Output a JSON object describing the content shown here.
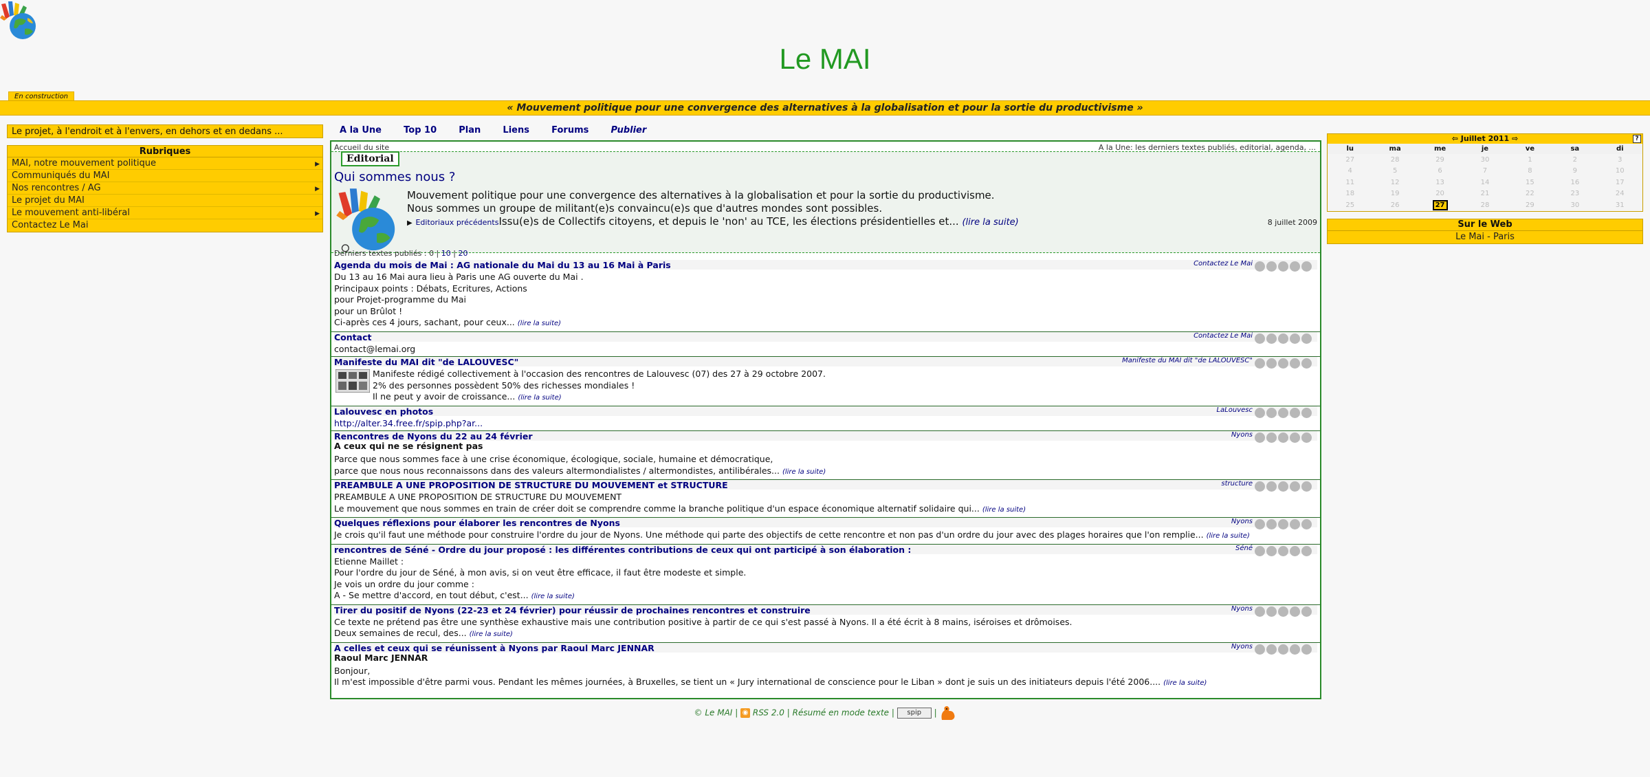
{
  "site": {
    "title": "Le MAI",
    "construction": "En construction",
    "slogan": "« Mouvement politique pour une convergence des alternatives à la globalisation et pour la sortie du productivisme »"
  },
  "left": {
    "projet_link": "Le projet, à l'endroit et à l'envers, en dehors et en dedans ...",
    "rubriques_title": "Rubriques",
    "rubriques": [
      {
        "label": "MAI, notre mouvement politique"
      },
      {
        "label": "Communiqués du MAI"
      },
      {
        "label": "Nos rencontres / AG"
      },
      {
        "label": "Le projet du MAI"
      },
      {
        "label": "Le mouvement anti-libéral"
      },
      {
        "label": "Contactez Le Mai"
      }
    ]
  },
  "nav": {
    "items": [
      "A la Une",
      "Top 10",
      "Plan",
      "Liens",
      "Forums",
      "Publier"
    ]
  },
  "center": {
    "crumb": "Accueil du site",
    "crumb_right": "A la Une: les derniers textes publiés, editorial, agenda, ...",
    "editorial_tab": "Editorial",
    "editorial_title": "Qui sommes nous ?",
    "editorial_line1": "Mouvement politique pour une convergence des alternatives à la globalisation et pour la sortie du productivisme.",
    "editorial_line2": "Nous sommes un groupe de militant(e)s convaincu(e)s que d'autres mondes sont possibles.",
    "editorial_prev": "Editoriaux précédents",
    "editorial_line3": "Issu(e)s de Collectifs citoyens, et depuis le 'non' au TCE, les élections présidentielles et...",
    "editorial_more": "(lire la suite)",
    "editorial_date": "8 juillet 2009",
    "derniers_label": "Derniers textes publiés : 0 |",
    "derniers_10": "10",
    "derniers_sep": "|",
    "derniers_20": "20",
    "lire": "(lire la suite)"
  },
  "articles": [
    {
      "title": "Agenda du mois de Mai : AG nationale du Mai du 13 au 16 Mai à Paris",
      "rubrique": "Contactez Le Mai",
      "lines": [
        "Du 13 au 16 Mai aura lieu à Paris une AG ouverte du Mai .",
        "Principaux points : Débats, Ecritures, Actions",
        "pour Projet-programme du Mai",
        "pour un Brûlot !",
        "Ci-après ces 4 jours, sachant, pour ceux..."
      ]
    },
    {
      "title": "Contact",
      "rubrique": "Contactez Le Mai",
      "lines": [
        "contact@lemai.org"
      ]
    },
    {
      "title": "Manifeste du MAI dit \"de LALOUVESC\"",
      "rubrique": "Manifeste du MAI dit \"de LALOUVESC\"",
      "lines": [
        "Manifeste rédigé collectivement à l'occasion des rencontres de Lalouvesc (07) des 27 à 29 octobre 2007.",
        "2% des personnes possèdent 50% des richesses mondiales !",
        "Il ne peut y avoir de croissance..."
      ]
    },
    {
      "title": "Lalouvesc en photos",
      "rubrique": "LaLouvesc",
      "lines": [
        "http://alter.34.free.fr/spip.php?ar..."
      ]
    },
    {
      "title": "Rencontres de Nyons du 22 au 24 février",
      "rubrique": "Nyons",
      "subtitle": "A ceux qui ne se résignent pas",
      "lines": [
        "Parce que nous sommes face à une crise économique, écologique, sociale, humaine et démocratique,",
        "parce que nous nous reconnaissons dans des valeurs altermondialistes / altermondistes, antilibérales..."
      ]
    },
    {
      "title": "PREAMBULE A UNE PROPOSITION DE STRUCTURE DU MOUVEMENT et STRUCTURE",
      "rubrique": "structure",
      "lines": [
        "PREAMBULE A UNE PROPOSITION DE STRUCTURE DU MOUVEMENT",
        "Le mouvement que nous sommes en train de créer doit se comprendre comme la branche politique d'un espace économique alternatif solidaire qui..."
      ]
    },
    {
      "title": "Quelques réflexions pour élaborer les rencontres de Nyons",
      "rubrique": "Nyons",
      "lines": [
        "Je crois qu'il faut une méthode pour construire l'ordre du jour de Nyons. Une méthode qui parte des objectifs de cette rencontre et non pas d'un ordre du jour avec des plages horaires que l'on remplie..."
      ]
    },
    {
      "title": "rencontres de Séné - Ordre du jour proposé : les différentes contributions de ceux qui ont participé à son élaboration :",
      "rubrique": "Séné",
      "lines": [
        "Etienne Maillet :",
        "Pour l'ordre du jour de Séné, à mon avis, si on veut être efficace, il faut être modeste et simple.",
        "Je vois un ordre du jour comme :",
        "A - Se mettre d'accord, en tout début, c'est..."
      ]
    },
    {
      "title": "Tirer du positif de Nyons (22-23 et 24 février) pour réussir de prochaines rencontres et construire",
      "rubrique": "Nyons",
      "lines": [
        "Ce texte ne prétend pas être une synthèse exhaustive mais une contribution positive à partir de ce qui s'est passé à Nyons. Il a été écrit à 8 mains, iséroises et drômoises.",
        "Deux semaines de recul, des..."
      ]
    },
    {
      "title": "A celles et ceux qui se réunissent à Nyons par Raoul Marc JENNAR",
      "rubrique": "Nyons",
      "subtitle": "Raoul Marc JENNAR",
      "lines": [
        "Bonjour,",
        "Il m'est impossible d'être parmi vous. Pendant les mêmes journées, à Bruxelles, se tient un « Jury international de conscience pour le Liban » dont je suis un des initiateurs depuis l'été 2006...."
      ]
    }
  ],
  "footer": {
    "copy": "© Le MAI",
    "sep": "|",
    "rss": "RSS 2.0",
    "resume": "Résumé en mode texte",
    "spip": "spip"
  },
  "calendar": {
    "title": "Juillet 2011",
    "help": "?",
    "days": [
      "lu",
      "ma",
      "me",
      "je",
      "ve",
      "sa",
      "di"
    ],
    "weeks": [
      [
        "27",
        "28",
        "29",
        "30",
        "1",
        "2",
        "3"
      ],
      [
        "4",
        "5",
        "6",
        "7",
        "8",
        "9",
        "10"
      ],
      [
        "11",
        "12",
        "13",
        "14",
        "15",
        "16",
        "17"
      ],
      [
        "18",
        "19",
        "20",
        "21",
        "22",
        "23",
        "24"
      ],
      [
        "25",
        "26",
        "27",
        "28",
        "29",
        "30",
        "31"
      ]
    ],
    "today": "27"
  },
  "web": {
    "title": "Sur le Web",
    "items": [
      "Le Mai - Paris"
    ]
  }
}
